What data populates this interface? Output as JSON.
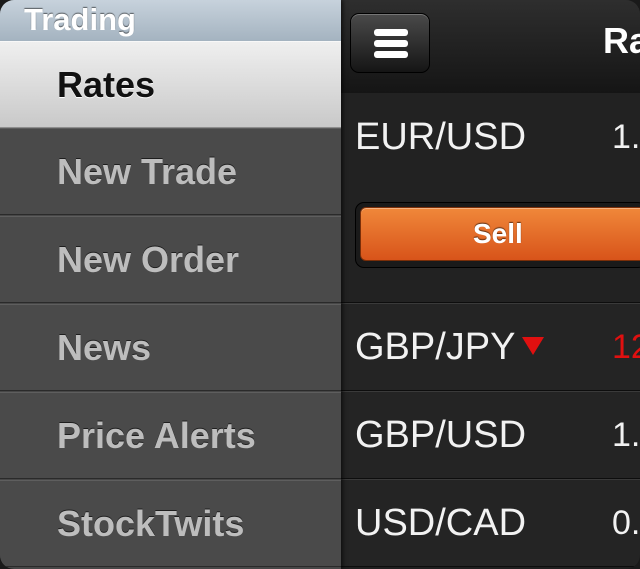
{
  "sidebar": {
    "section_title": "Trading",
    "items": [
      {
        "label": "Rates"
      },
      {
        "label": "New Trade"
      },
      {
        "label": "New Order"
      },
      {
        "label": "News"
      },
      {
        "label": "Price Alerts"
      },
      {
        "label": "StockTwits"
      }
    ]
  },
  "main": {
    "title": "Ra",
    "expanded": {
      "pair": "EUR/USD",
      "price": "1.",
      "sell_label": "Sell"
    },
    "rows": [
      {
        "pair": "GBP/JPY",
        "price": "12",
        "direction": "down"
      },
      {
        "pair": "GBP/USD",
        "price": "1.",
        "direction": "none"
      },
      {
        "pair": "USD/CAD",
        "price": "0.",
        "direction": "none"
      }
    ]
  },
  "colors": {
    "sell_button": "#e86a28",
    "down_indicator": "#e01010",
    "section_header": "#b4c2ce"
  },
  "icons": {
    "menu": "hamburger-icon",
    "down": "down-arrow-icon"
  }
}
